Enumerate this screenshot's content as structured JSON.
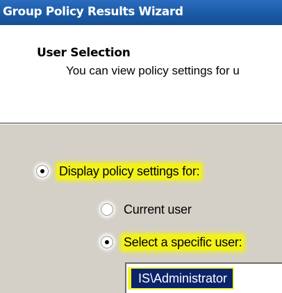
{
  "window": {
    "title": "Group Policy Results Wizard"
  },
  "header": {
    "title": "User Selection",
    "description": "You can view policy settings for u"
  },
  "options": {
    "display_for": {
      "label": "Display policy settings for:",
      "checked": true
    },
    "current_user": {
      "label": "Current user",
      "checked": false
    },
    "specific_user": {
      "label": "Select a specific user:",
      "checked": true
    }
  },
  "user_field": {
    "value": "IS\\Administrator"
  },
  "colors": {
    "title_bar": "#1b5aa4",
    "dialog_background": "#d4d0c8",
    "highlight": "#f2f21a",
    "selection": "#0a246a"
  },
  "icons": {
    "radio_checked": "radio-checked-icon",
    "radio_unchecked": "radio-unchecked-icon"
  }
}
